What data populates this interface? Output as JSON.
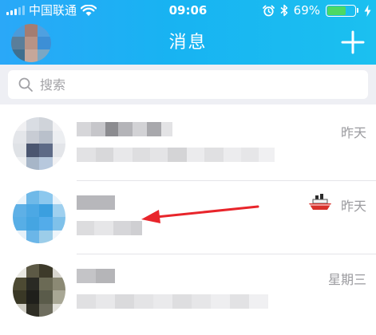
{
  "status_bar": {
    "carrier": "中国联通",
    "time": "09:06",
    "battery": "69%",
    "battery_level": 0.69,
    "battery_color": "#4cd964"
  },
  "nav": {
    "title": "消息",
    "add_icon": "plus-icon",
    "avatar_icon": "profile-avatar"
  },
  "search": {
    "placeholder": "搜索",
    "icon": "search-icon"
  },
  "conversations": [
    {
      "time": "昨天",
      "avatar": "blurred-avatar"
    },
    {
      "time": "昨天",
      "avatar": "blurred-avatar",
      "badge_icon": "boat-icon"
    },
    {
      "time": "星期三",
      "avatar": "blurred-avatar"
    }
  ],
  "annotation": {
    "icon": "red-arrow",
    "color": "#e8252b"
  },
  "colors": {
    "header_start": "#2aa8f8",
    "header_end": "#1bc0f0",
    "search_bg": "#eeeff4",
    "secondary_text": "#9b9b9f"
  }
}
